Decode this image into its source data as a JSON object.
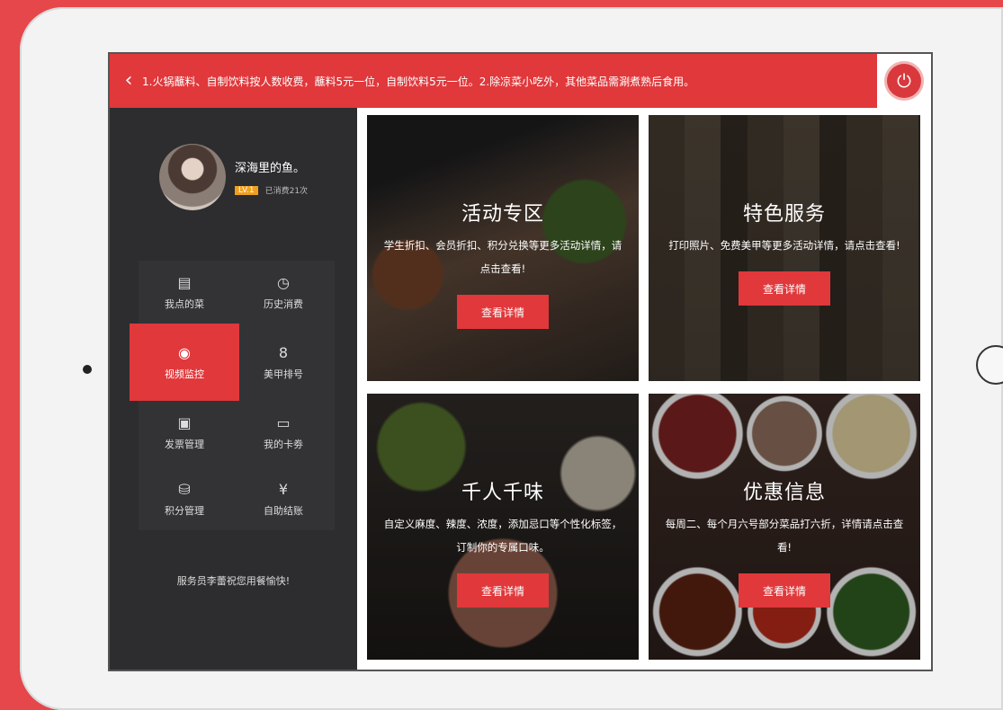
{
  "topbar": {
    "notice": "1.火锅蘸料、自制饮料按人数收费，蘸料5元一位，自制饮料5元一位。2.除凉菜小吃外，其他菜品需涮煮熟后食用。"
  },
  "profile": {
    "username": "深海里的鱼。",
    "level": "LV.1",
    "consumed": "已消费21次"
  },
  "menu": [
    {
      "label": "我点的菜",
      "icon": "clipboard-icon",
      "glyph": "▤"
    },
    {
      "label": "历史消费",
      "icon": "clock-icon",
      "glyph": "◷"
    },
    {
      "label": "视频监控",
      "icon": "camera-icon",
      "glyph": "◉"
    },
    {
      "label": "美甲排号",
      "icon": "ticket-number-icon",
      "glyph": "8"
    },
    {
      "label": "发票管理",
      "icon": "invoice-icon",
      "glyph": "▣"
    },
    {
      "label": "我的卡劵",
      "icon": "coupon-icon",
      "glyph": "▭"
    },
    {
      "label": "积分管理",
      "icon": "points-icon",
      "glyph": "⛁"
    },
    {
      "label": "自助结账",
      "icon": "yen-icon",
      "glyph": "¥"
    }
  ],
  "waiter": "服务员李蕾祝您用餐愉快!",
  "cards": [
    {
      "title": "活动专区",
      "desc": "学生折扣、会员折扣、积分兑换等更多活动详情，请点击查看!",
      "button": "查看详情"
    },
    {
      "title": "特色服务",
      "desc": "打印照片、免费美甲等更多活动详情，请点击查看!",
      "button": "查看详情"
    },
    {
      "title": "千人千味",
      "desc": "自定义麻度、辣度、浓度，添加忌口等个性化标签，订制你的专属口味。",
      "button": "查看详情"
    },
    {
      "title": "优惠信息",
      "desc": "每周二、每个月六号部分菜品打六折，详情请点击查看!",
      "button": "查看详情"
    }
  ],
  "colors": {
    "accent": "#e0383b",
    "sidebar": "#2d2d2f",
    "level_badge": "#f0a020"
  }
}
